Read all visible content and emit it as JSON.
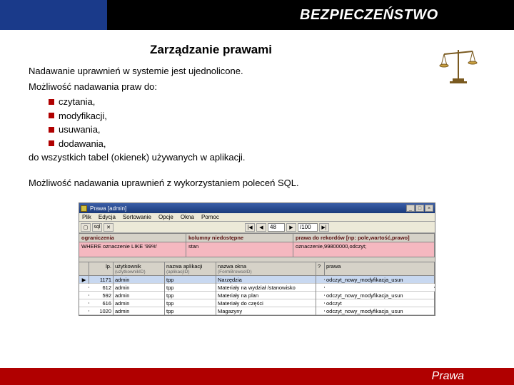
{
  "header": {
    "title": "BEZPIECZEŃSTWO"
  },
  "subtitle": "Zarządzanie prawami",
  "body": {
    "line1": "Nadawanie uprawnień w systemie jest ujednolicone.",
    "line2": "Możliwość nadawania praw do:",
    "bullets": [
      "czytania,",
      "modyfikacji,",
      "usuwania,",
      "dodawania,"
    ],
    "line3": "do wszystkich tabel (okienek) używanych w aplikacji.",
    "line4": "Możliwość nadawania uprawnień z wykorzystaniem poleceń SQL."
  },
  "app": {
    "window_title": "Prawa [admin]",
    "menu": [
      "Plik",
      "Edycja",
      "Sortowanie",
      "Opcje",
      "Okna",
      "Pomoc"
    ],
    "toolbar": {
      "btn_open": "▢",
      "btn_find": "sql",
      "btn_x": "✕",
      "nav_first": "|◀",
      "nav_prev": "◀",
      "page_cur": "48",
      "nav_next": "▶",
      "page_total": "/100",
      "nav_last": "▶|"
    },
    "sections": {
      "h1": "ograniczenia",
      "h2": "kolumny niedostępne",
      "h3": "prawa do rekordów [np: pole,wartość,prawo]",
      "v1": "WHERE oznaczenie LIKE '99%'",
      "v2": "stan",
      "v3": "oznaczenie,99800000,odczyt;"
    },
    "grid": {
      "headers": {
        "lp": "lp.",
        "user": "użytkownik",
        "user_sub": "(uzytkownikID)",
        "app": "nazwa aplikacji",
        "app_sub": "(aplikacjID)",
        "win": "nazwa okna",
        "win_sub": "(FormBrowseID)",
        "prawa_col": "?",
        "prawa": "prawa"
      },
      "rows": [
        {
          "lp": "1171",
          "user": "admin",
          "app": "tpp",
          "win": "Narzędzia",
          "p": "",
          "prawa": "odczyt_nowy_modyfikacja_usun"
        },
        {
          "lp": "612",
          "user": "admin",
          "app": "tpp",
          "win": "Materiały na wydział /stanowisko",
          "p": "",
          "prawa": ""
        },
        {
          "lp": "592",
          "user": "admin",
          "app": "tpp",
          "win": "Materiały na plan",
          "p": "",
          "prawa": "odczyt_nowy_modyfikacja_usun"
        },
        {
          "lp": "616",
          "user": "admin",
          "app": "tpp",
          "win": "Materiały do części",
          "p": "",
          "prawa": "odczyt"
        },
        {
          "lp": "1020",
          "user": "admin",
          "app": "tpp",
          "win": "Magazyny",
          "p": "",
          "prawa": "odczyt_nowy_modyfikacja_usun"
        }
      ]
    }
  },
  "footer": {
    "label": "Prawa"
  }
}
